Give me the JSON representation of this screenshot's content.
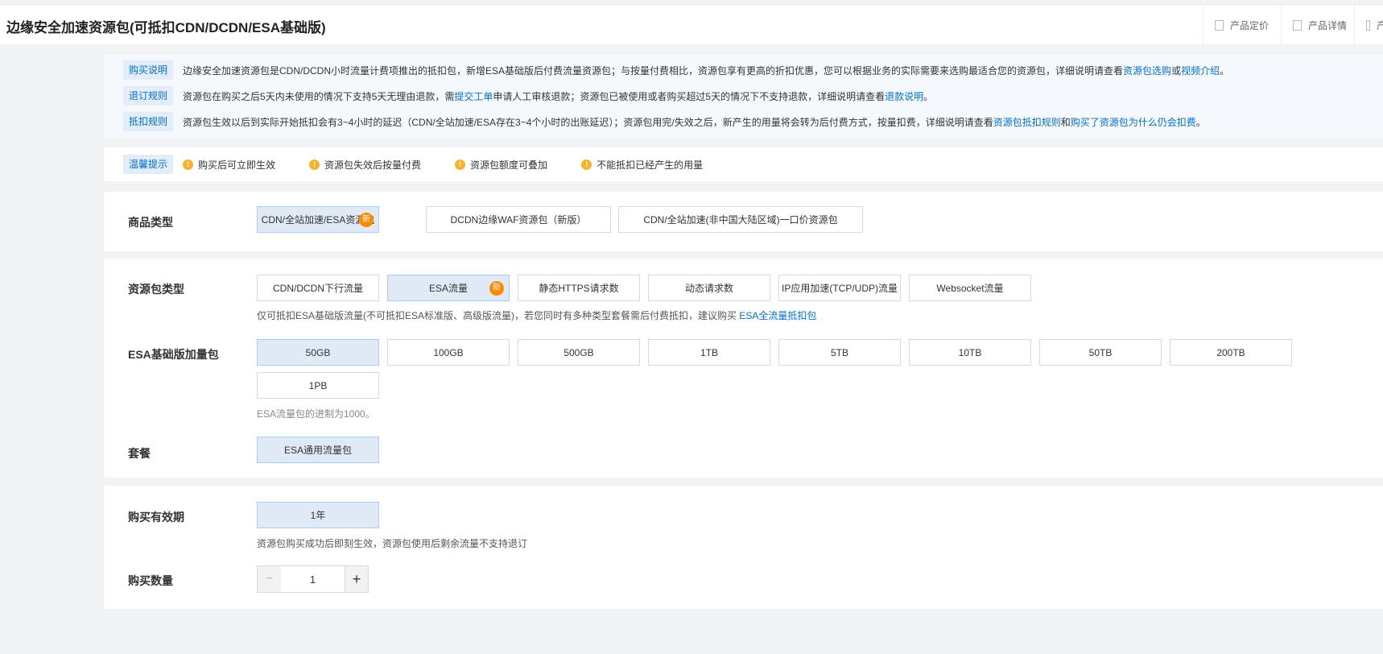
{
  "header": {
    "title": "边缘安全加速资源包(可抵扣CDN/DCDN/ESA基础版)",
    "tabs": [
      {
        "label": "产品定价",
        "icon": "bookmark-icon"
      },
      {
        "label": "产品详情",
        "icon": "list-icon"
      },
      {
        "label": "产",
        "icon": "document-icon"
      }
    ]
  },
  "info": [
    {
      "tag": "购买说明",
      "parts": [
        {
          "t": "边缘安全加速资源包是CDN/DCDN小时流量计费项推出的抵扣包，新增ESA基础版后付费流量资源包；与按量付费相比，资源包享有更高的折扣优惠，您可以根据业务的实际需要来选购最适合您的资源包，详细说明请查看"
        },
        {
          "t": "资源包选购",
          "link": true
        },
        {
          "t": "或"
        },
        {
          "t": "视频介绍",
          "link": true
        },
        {
          "t": "。"
        }
      ]
    },
    {
      "tag": "退订规则",
      "parts": [
        {
          "t": "资源包在购买之后5天内未使用的情况下支持5天无理由退款，需"
        },
        {
          "t": "提交工单",
          "link": true
        },
        {
          "t": "申请人工审核退款；资源包已被使用或者购买超过5天的情况下不支持退款，详细说明请查看"
        },
        {
          "t": "退款说明",
          "link": true
        },
        {
          "t": "。"
        }
      ]
    },
    {
      "tag": "抵扣规则",
      "parts": [
        {
          "t": "资源包生效以后到实际开始抵扣会有3~4小时的延迟（CDN/全站加速/ESA存在3~4个小时的出账延迟）；资源包用完/失效之后，新产生的用量将会转为后付费方式，按量扣费，详细说明请查看"
        },
        {
          "t": "资源包抵扣规则",
          "link": true
        },
        {
          "t": "和"
        },
        {
          "t": "购买了资源包为什么仍会扣费",
          "link": true
        },
        {
          "t": "。"
        }
      ]
    }
  ],
  "tips": {
    "tag": "温馨提示",
    "items": [
      "购买后可立即生效",
      "资源包失效后按量付费",
      "资源包额度可叠加",
      "不能抵扣已经产生的用量"
    ]
  },
  "product_type": {
    "label": "商品类型",
    "options": [
      "CDN/全站加速/ESA资源包",
      "DCDN边缘WAF资源包（新版）",
      "CDN/全站加速(非中国大陆区域)一口价资源包"
    ],
    "selected": 0,
    "badge": "新"
  },
  "package_type": {
    "label": "资源包类型",
    "options": [
      "CDN/DCDN下行流量",
      "ESA流量",
      "静态HTTPS请求数",
      "动态请求数",
      "IP应用加速(TCP/UDP)流量",
      "Websocket流量"
    ],
    "selected": 1,
    "badge": "新",
    "note": "仅可抵扣ESA基础版流量(不可抵扣ESA标准版、高级版流量)，若您同时有多种类型套餐需后付费抵扣，建议购买 ",
    "note_link": "ESA全流量抵扣包"
  },
  "esa_addon": {
    "label": "ESA基础版加量包",
    "options": [
      "50GB",
      "100GB",
      "500GB",
      "1TB",
      "5TB",
      "10TB",
      "50TB",
      "200TB",
      "1PB"
    ],
    "selected": 0,
    "note": "ESA流量包的进制为1000。"
  },
  "plan": {
    "label": "套餐",
    "options": [
      "ESA通用流量包"
    ],
    "selected": 0
  },
  "validity": {
    "label": "购买有效期",
    "options": [
      "1年"
    ],
    "selected": 0,
    "note": "资源包购买成功后即刻生效，资源包使用后剩余流量不支持退订"
  },
  "quantity": {
    "label": "购买数量",
    "value": "1",
    "minus": "−",
    "plus": "+"
  },
  "colors": {
    "accent": "#0070cc",
    "badge": "#ff8a00",
    "warn": "#f7b32b",
    "selected_bg": "#e0eaf7"
  }
}
